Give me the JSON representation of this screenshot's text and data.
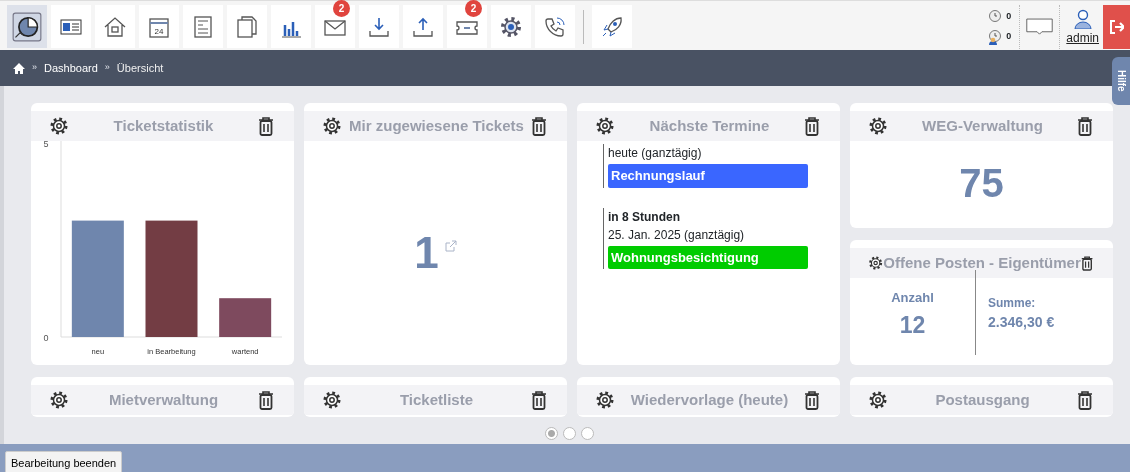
{
  "toolbar": {
    "items": [
      {
        "selected": true
      },
      {
        "selected": false
      },
      {
        "selected": false
      },
      {
        "selected": false,
        "label": "24"
      },
      {
        "selected": false
      },
      {
        "selected": false
      },
      {
        "selected": false
      },
      {
        "selected": false,
        "badge": "2"
      },
      {
        "selected": false
      },
      {
        "selected": false
      },
      {
        "selected": false,
        "badge": "2"
      },
      {
        "selected": false
      },
      {
        "selected": false
      },
      {
        "selected": false
      }
    ],
    "counters": [
      {
        "value": "0"
      },
      {
        "value": "0"
      }
    ],
    "user": {
      "name": "admin"
    }
  },
  "breadcrumb": [
    {
      "kind": "separator",
      "text": "»"
    },
    {
      "kind": "link",
      "text": "Dashboard"
    },
    {
      "kind": "separator",
      "text": "»"
    },
    {
      "kind": "current",
      "text": "Übersicht"
    }
  ],
  "help_tab": {
    "label": "Hilfe"
  },
  "widgets": [
    {
      "kind": "chart",
      "title": "Ticketstatistik",
      "chart_data": {
        "type": "bar",
        "categories": [
          "neu",
          "in Bearbeitung",
          "wartend"
        ],
        "values": [
          3,
          3,
          1
        ],
        "colors": [
          "#6f86ad",
          "#733d44",
          "#7e4a5e"
        ],
        "ylim": [
          0,
          5
        ],
        "yticks": [
          0,
          5
        ]
      }
    },
    {
      "kind": "counter",
      "title": "Mir zugewiesene Tickets",
      "value": "1"
    },
    {
      "kind": "agenda",
      "title": "Nächste Termine",
      "events": [
        {
          "date": "heute (ganztägig)",
          "title": "Rechnungslauf",
          "color": "#3a66ff"
        },
        {
          "relative": "in 8 Stunden",
          "date": "25. Jan. 2025 (ganztägig)",
          "title": "Wohnungsbesichtigung",
          "color": "#00cc00"
        }
      ]
    },
    {
      "kind": "number",
      "title": "WEG-Verwaltung",
      "value": "75"
    },
    {
      "kind": "totals",
      "title": "Offene Posten - Eigentümer",
      "count_label": "Anzahl",
      "count": "12",
      "sum_label": "Summe:",
      "sum": "2.346,30 €"
    },
    {
      "kind": "collapsed",
      "title": "Mietverwaltung"
    },
    {
      "kind": "collapsed",
      "title": "Ticketliste"
    },
    {
      "kind": "collapsed",
      "title": "Wiedervorlage (heute)"
    },
    {
      "kind": "collapsed",
      "title": "Postausgang"
    }
  ],
  "pager": [
    {
      "selected": true
    },
    {
      "selected": false
    },
    {
      "selected": false
    }
  ],
  "footer": {
    "button": "Bearbeitung beenden"
  }
}
